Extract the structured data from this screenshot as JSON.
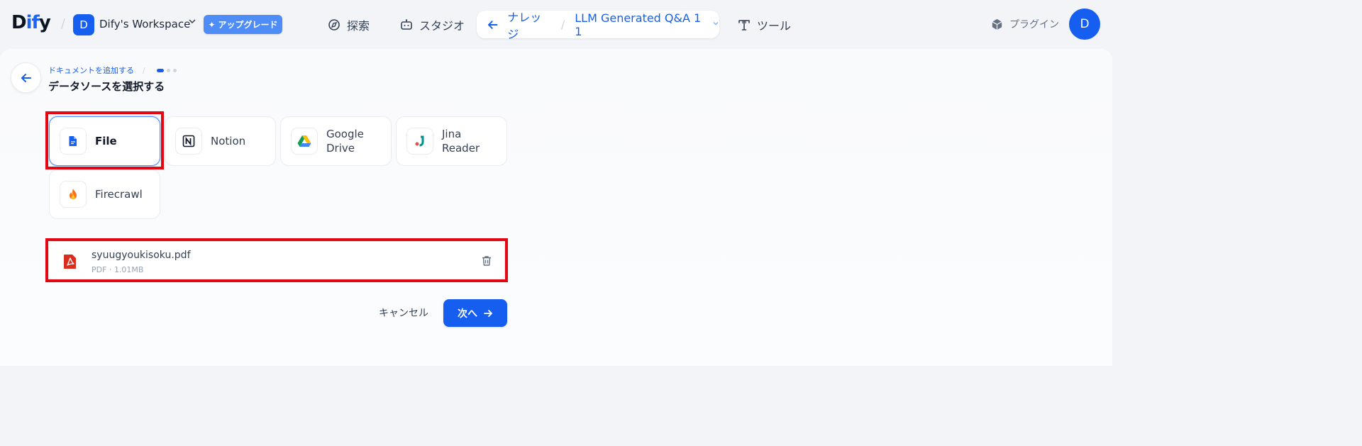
{
  "header": {
    "logo_d": "D",
    "logo_ify": "if",
    "logo_y": "y",
    "workspace_initial": "D",
    "workspace_name": "Dify's Workspace",
    "upgrade_label": "アップグレード",
    "nav": {
      "explore": "探索",
      "studio": "スタジオ",
      "knowledge": "ナレッジ",
      "dataset_name": "LLM Generated Q&A 1 1",
      "tools": "ツール",
      "plugins": "プラグイン"
    },
    "user_initial": "D"
  },
  "main": {
    "breadcrumb": "ドキュメントを追加する",
    "title": "データソースを選択する",
    "step_current": 1,
    "step_total": 3,
    "sources": [
      {
        "label": "File",
        "icon": "file-icon",
        "selected": true
      },
      {
        "label": "Notion",
        "icon": "notion-icon",
        "selected": false
      },
      {
        "label": "Google\nDrive",
        "icon": "google-drive-icon",
        "selected": false
      },
      {
        "label": "Jina\nReader",
        "icon": "jina-reader-icon",
        "selected": false
      },
      {
        "label": "Firecrawl",
        "icon": "firecrawl-icon",
        "selected": false
      }
    ],
    "file": {
      "name": "syuugyoukisoku.pdf",
      "type": "PDF",
      "size": "1.01MB"
    },
    "cancel_label": "キャンセル",
    "next_label": "次へ"
  },
  "colors": {
    "primary": "#155eef",
    "highlight": "#e30613",
    "pdf": "#d92d20"
  }
}
